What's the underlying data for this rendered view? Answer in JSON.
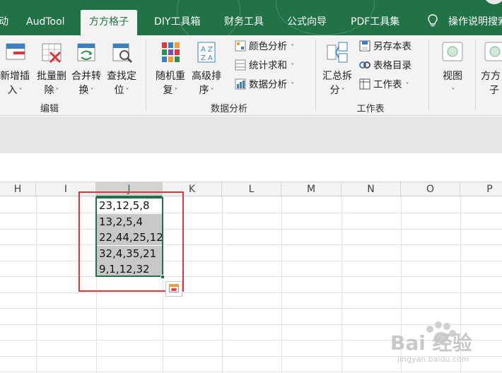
{
  "tabs": [
    {
      "label": "动",
      "active": false
    },
    {
      "label": "AudTool",
      "active": false
    },
    {
      "label": "方方格子",
      "active": true
    },
    {
      "label": "DIY工具箱",
      "active": false
    },
    {
      "label": "财务工具",
      "active": false
    },
    {
      "label": "公式向导",
      "active": false
    },
    {
      "label": "PDF工具集",
      "active": false
    }
  ],
  "help_label": "操作说明搜索",
  "ribbon": {
    "edit_group": {
      "label": "编辑",
      "buttons": [
        {
          "line1": "新增插",
          "line2": "入"
        },
        {
          "line1": "批量删",
          "line2": "除"
        },
        {
          "line1": "合并转",
          "line2": "换"
        },
        {
          "line1": "查找定",
          "line2": "位"
        }
      ]
    },
    "data_group": {
      "label": "数据分析",
      "buttons": [
        {
          "line1": "随机重",
          "line2": "复"
        },
        {
          "line1": "高级排",
          "line2": "序"
        }
      ],
      "small": [
        "颜色分析",
        "统计求和",
        "数据分析"
      ]
    },
    "sheet_group": {
      "label": "工作表",
      "button": {
        "line1": "汇总拆",
        "line2": "分"
      },
      "small": [
        "另存本表",
        "表格目录",
        "工作表"
      ]
    },
    "view_button": "视图",
    "ffgz_button": {
      "line1": "方方",
      "line2": "子"
    }
  },
  "columns": [
    "H",
    "I",
    "J",
    "K",
    "L",
    "M",
    "N",
    "O",
    "P"
  ],
  "selected_column": "J",
  "cells": [
    "23,12,5,8",
    "13,2,5,4",
    "22,44,25,12",
    "32,4,35,21",
    "9,1,12,32"
  ],
  "colors": {
    "accent": "#217346",
    "highlight_box": "#e0353b",
    "selection_fill": "#c8c8c8"
  },
  "watermark": {
    "main": "Bai 经验",
    "sub": "jingyan.baidu.com"
  }
}
